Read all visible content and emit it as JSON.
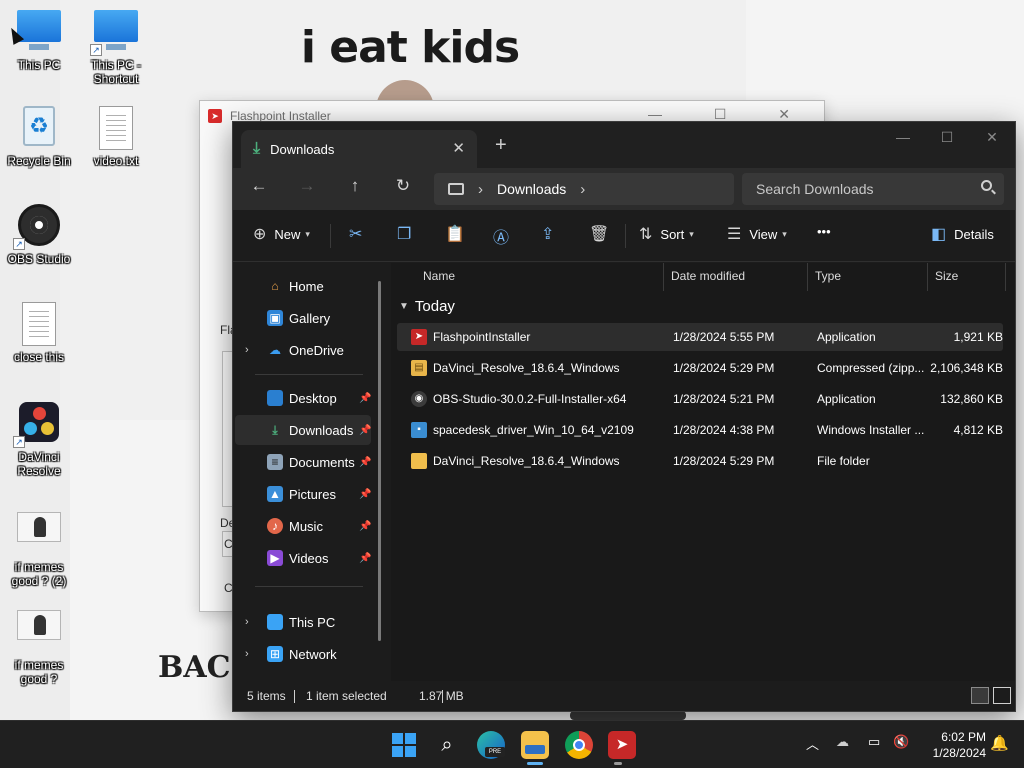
{
  "wallpaper": {
    "caption": "i eat kids",
    "bottom_text": "BAC"
  },
  "desktop_icons": [
    {
      "label": "This PC",
      "icon": "monitor-icon"
    },
    {
      "label": "This PC - Shortcut",
      "icon": "monitor-icon"
    },
    {
      "label": "Recycle Bin",
      "icon": "recycle-bin-icon"
    },
    {
      "label": "video.txt",
      "icon": "text-file-icon"
    },
    {
      "label": "OBS Studio",
      "icon": "obs-icon"
    },
    {
      "label": "close this",
      "icon": "text-file-icon"
    },
    {
      "label": "DaVinci Resolve",
      "icon": "davinci-icon"
    },
    {
      "label": "if memes good ? (2)",
      "icon": "image-file-icon"
    },
    {
      "label": "if memes good ?",
      "icon": "image-file-icon"
    }
  ],
  "installer": {
    "title": "Flashpoint Installer",
    "fragments": [
      "Fla",
      "De",
      "C",
      "C"
    ]
  },
  "explorer": {
    "tab_title": "Downloads",
    "address": {
      "segment": "Downloads"
    },
    "search": {
      "placeholder": "Search Downloads"
    },
    "commands": {
      "new": "New",
      "sort": "Sort",
      "view": "View",
      "more": "•••",
      "details": "Details"
    },
    "sidebar": {
      "items": [
        {
          "label": "Home",
          "icon": "home-icon",
          "pinned": false
        },
        {
          "label": "Gallery",
          "icon": "gallery-icon",
          "pinned": false
        },
        {
          "label": "OneDrive",
          "icon": "onedrive-icon",
          "pinned": false
        },
        {
          "label": "Desktop",
          "icon": "desktop-icon",
          "pinned": true
        },
        {
          "label": "Downloads",
          "icon": "downloads-icon",
          "pinned": true
        },
        {
          "label": "Documents",
          "icon": "documents-icon",
          "pinned": true
        },
        {
          "label": "Pictures",
          "icon": "pictures-icon",
          "pinned": true
        },
        {
          "label": "Music",
          "icon": "music-icon",
          "pinned": true
        },
        {
          "label": "Videos",
          "icon": "videos-icon",
          "pinned": true
        },
        {
          "label": "This PC",
          "icon": "this-pc-icon",
          "pinned": false
        },
        {
          "label": "Network",
          "icon": "network-icon",
          "pinned": false
        }
      ]
    },
    "columns": {
      "name": "Name",
      "date": "Date modified",
      "type": "Type",
      "size": "Size"
    },
    "group": "Today",
    "files": [
      {
        "name": "FlashpointInstaller",
        "date": "1/28/2024 5:55 PM",
        "type": "Application",
        "size": "1,921 KB",
        "icon": "flashpoint-app-icon"
      },
      {
        "name": "DaVinci_Resolve_18.6.4_Windows",
        "date": "1/28/2024 5:29 PM",
        "type": "Compressed (zipp...",
        "size": "2,106,348 KB",
        "icon": "zip-folder-icon"
      },
      {
        "name": "OBS-Studio-30.0.2-Full-Installer-x64",
        "date": "1/28/2024 5:21 PM",
        "type": "Application",
        "size": "132,860 KB",
        "icon": "obs-installer-icon"
      },
      {
        "name": "spacedesk_driver_Win_10_64_v2109",
        "date": "1/28/2024 4:38 PM",
        "type": "Windows Installer ...",
        "size": "4,812 KB",
        "icon": "msi-installer-icon"
      },
      {
        "name": "DaVinci_Resolve_18.6.4_Windows",
        "date": "1/28/2024 5:29 PM",
        "type": "File folder",
        "size": "",
        "icon": "folder-icon"
      }
    ],
    "status": {
      "items": "5 items",
      "selected": "1 item selected",
      "size": "1.87 MB"
    }
  },
  "taskbar": {
    "time": "6:02 PM",
    "date": "1/28/2024",
    "edge_badge": "PRE"
  },
  "colors": {
    "accent": "#5fb2f2",
    "explorer_bg": "#1c1c1c",
    "taskbar_bg": "#202020"
  }
}
